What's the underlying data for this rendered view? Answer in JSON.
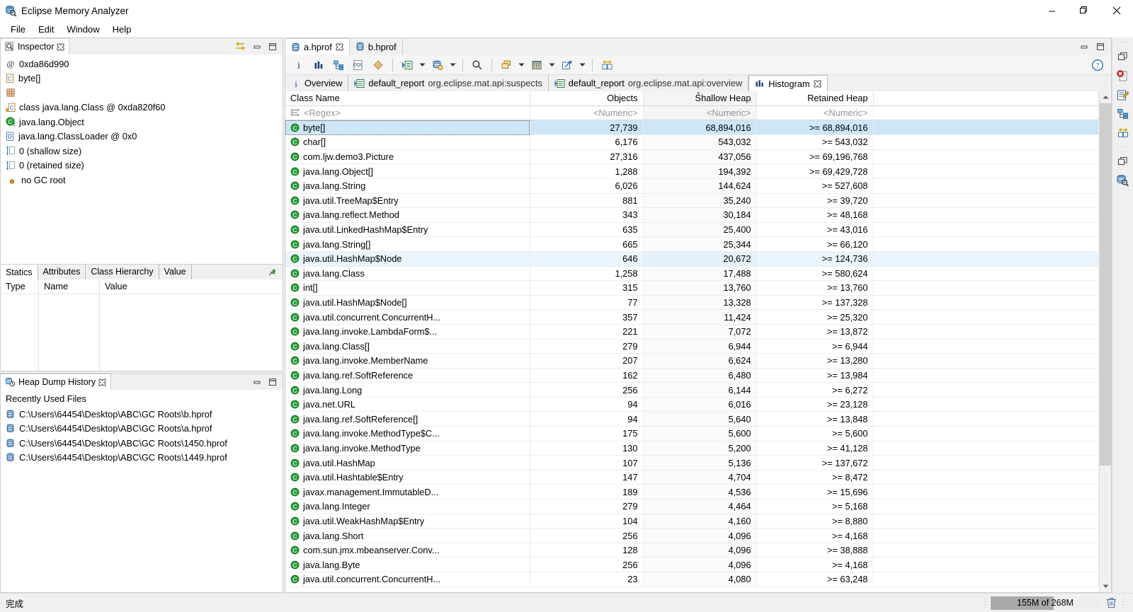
{
  "window": {
    "title": "Eclipse Memory Analyzer",
    "app_icon": "heap-dump-icon",
    "controls": {
      "minimize": "—",
      "maximize": "❐",
      "close": "✕"
    }
  },
  "menubar": {
    "items": [
      "File",
      "Edit",
      "Window",
      "Help"
    ]
  },
  "inspector": {
    "tab_label": "Inspector",
    "tab_icon": "inspector-icon",
    "tools": [
      "link-with-selection-icon",
      "minimize-view-icon",
      "maximize-view-icon"
    ],
    "lines": [
      {
        "icon": "at-address-icon",
        "text": "0xda86d990"
      },
      {
        "icon": "class-object-icon",
        "text": "byte[]"
      },
      {
        "icon": "array-grid-icon",
        "text": ""
      },
      {
        "icon": "class-ref-icon",
        "text": "class java.lang.Class @ 0xda820f60"
      },
      {
        "icon": "superclass-icon",
        "text": "java.lang.Object"
      },
      {
        "icon": "classloader-icon",
        "text": "java.lang.ClassLoader @ 0x0"
      },
      {
        "icon": "shallow-size-icon",
        "text": "0 (shallow size)"
      },
      {
        "icon": "retained-size-icon",
        "text": "0 (retained size)"
      },
      {
        "icon": "gc-root-icon",
        "text": "no GC root"
      }
    ],
    "tabs": [
      {
        "label": "Statics",
        "active": true
      },
      {
        "label": "Attributes",
        "active": false
      },
      {
        "label": "Class Hierarchy",
        "active": false
      },
      {
        "label": "Value",
        "active": false
      }
    ],
    "pin_icon": "pin-icon",
    "statics_columns": [
      "Type",
      "Name",
      "Value"
    ]
  },
  "heap_dump_history": {
    "tab_label": "Heap Dump History",
    "tab_icon": "heap-history-icon",
    "tools": [
      "minimize-view-icon",
      "maximize-view-icon"
    ],
    "section_title": "Recently Used Files",
    "files": [
      "C:\\Users\\64454\\Desktop\\ABC\\GC Roots\\b.hprof",
      "C:\\Users\\64454\\Desktop\\ABC\\GC Roots\\a.hprof",
      "C:\\Users\\64454\\Desktop\\ABC\\GC Roots\\1450.hprof",
      "C:\\Users\\64454\\Desktop\\ABC\\GC Roots\\1449.hprof"
    ]
  },
  "editor": {
    "tabs": [
      {
        "label": "a.hprof",
        "active": true,
        "closable": true
      },
      {
        "label": "b.hprof",
        "active": false,
        "closable": false
      }
    ],
    "tools": [
      "minimize-editor-icon",
      "maximize-editor-icon"
    ],
    "toolbar": [
      {
        "name": "overview-info-icon",
        "dropdown": false
      },
      {
        "name": "histogram-icon",
        "dropdown": false
      },
      {
        "name": "dominator-tree-icon",
        "dropdown": false
      },
      {
        "name": "oql-icon",
        "dropdown": false
      },
      {
        "name": "calculate-retained-icon",
        "dropdown": false
      },
      {
        "name": "run-report-icon",
        "dropdown": true
      },
      {
        "name": "query-browser-icon",
        "dropdown": true
      },
      {
        "name": "find-icon",
        "dropdown": false
      },
      {
        "name": "group-by-icon",
        "dropdown": true
      },
      {
        "name": "calculator-icon",
        "dropdown": true
      },
      {
        "name": "export-icon",
        "dropdown": true
      },
      {
        "name": "compare-icon",
        "dropdown": false
      }
    ],
    "help_icon": "help-icon",
    "result_tabs": [
      {
        "icon": "info-icon",
        "label": "Overview",
        "sublabel": "",
        "active": false
      },
      {
        "icon": "report-icon",
        "label": "default_report",
        "sublabel": "org.eclipse.mat.api:suspects",
        "active": false
      },
      {
        "icon": "report-icon",
        "label": "default_report",
        "sublabel": "org.eclipse.mat.api:overview",
        "active": false
      },
      {
        "icon": "histogram-icon",
        "label": "Histogram",
        "sublabel": "",
        "active": true,
        "closable": true
      }
    ]
  },
  "histogram": {
    "columns": [
      {
        "label": "Class Name",
        "align": "left",
        "sorted": false
      },
      {
        "label": "Objects",
        "align": "right",
        "sorted": false
      },
      {
        "label": "Shallow Heap",
        "align": "right",
        "sorted": true
      },
      {
        "label": "Retained Heap",
        "align": "right",
        "sorted": false
      }
    ],
    "filter_row": {
      "icon": "regex-filter-icon",
      "class_name": "<Regex>",
      "objects": "<Numeric>",
      "shallow": "<Numeric>",
      "retained": "<Numeric>"
    },
    "row_icon": "java-class-icon",
    "rows": [
      {
        "class_name": "byte[]",
        "objects": "27,739",
        "shallow": "68,894,016",
        "retained": ">= 68,894,016",
        "state": "selected"
      },
      {
        "class_name": "char[]",
        "objects": "6,176",
        "shallow": "543,032",
        "retained": ">= 543,032",
        "state": ""
      },
      {
        "class_name": "com.ljw.demo3.Picture",
        "objects": "27,316",
        "shallow": "437,056",
        "retained": ">= 69,196,768",
        "state": ""
      },
      {
        "class_name": "java.lang.Object[]",
        "objects": "1,288",
        "shallow": "194,392",
        "retained": ">= 69,429,728",
        "state": ""
      },
      {
        "class_name": "java.lang.String",
        "objects": "6,026",
        "shallow": "144,624",
        "retained": ">= 527,608",
        "state": ""
      },
      {
        "class_name": "java.util.TreeMap$Entry",
        "objects": "881",
        "shallow": "35,240",
        "retained": ">= 39,720",
        "state": ""
      },
      {
        "class_name": "java.lang.reflect.Method",
        "objects": "343",
        "shallow": "30,184",
        "retained": ">= 48,168",
        "state": ""
      },
      {
        "class_name": "java.util.LinkedHashMap$Entry",
        "objects": "635",
        "shallow": "25,400",
        "retained": ">= 43,016",
        "state": ""
      },
      {
        "class_name": "java.lang.String[]",
        "objects": "665",
        "shallow": "25,344",
        "retained": ">= 66,120",
        "state": ""
      },
      {
        "class_name": "java.util.HashMap$Node",
        "objects": "646",
        "shallow": "20,672",
        "retained": ">= 124,736",
        "state": "hl"
      },
      {
        "class_name": "java.lang.Class",
        "objects": "1,258",
        "shallow": "17,488",
        "retained": ">= 580,624",
        "state": ""
      },
      {
        "class_name": "int[]",
        "objects": "315",
        "shallow": "13,760",
        "retained": ">= 13,760",
        "state": ""
      },
      {
        "class_name": "java.util.HashMap$Node[]",
        "objects": "77",
        "shallow": "13,328",
        "retained": ">= 137,328",
        "state": ""
      },
      {
        "class_name": "java.util.concurrent.ConcurrentH...",
        "objects": "357",
        "shallow": "11,424",
        "retained": ">= 25,320",
        "state": ""
      },
      {
        "class_name": "java.lang.invoke.LambdaForm$...",
        "objects": "221",
        "shallow": "7,072",
        "retained": ">= 13,872",
        "state": ""
      },
      {
        "class_name": "java.lang.Class[]",
        "objects": "279",
        "shallow": "6,944",
        "retained": ">= 6,944",
        "state": ""
      },
      {
        "class_name": "java.lang.invoke.MemberName",
        "objects": "207",
        "shallow": "6,624",
        "retained": ">= 13,280",
        "state": ""
      },
      {
        "class_name": "java.lang.ref.SoftReference",
        "objects": "162",
        "shallow": "6,480",
        "retained": ">= 13,984",
        "state": ""
      },
      {
        "class_name": "java.lang.Long",
        "objects": "256",
        "shallow": "6,144",
        "retained": ">= 6,272",
        "state": ""
      },
      {
        "class_name": "java.net.URL",
        "objects": "94",
        "shallow": "6,016",
        "retained": ">= 23,128",
        "state": ""
      },
      {
        "class_name": "java.lang.ref.SoftReference[]",
        "objects": "94",
        "shallow": "5,640",
        "retained": ">= 13,848",
        "state": ""
      },
      {
        "class_name": "java.lang.invoke.MethodType$C...",
        "objects": "175",
        "shallow": "5,600",
        "retained": ">= 5,600",
        "state": ""
      },
      {
        "class_name": "java.lang.invoke.MethodType",
        "objects": "130",
        "shallow": "5,200",
        "retained": ">= 41,128",
        "state": ""
      },
      {
        "class_name": "java.util.HashMap",
        "objects": "107",
        "shallow": "5,136",
        "retained": ">= 137,672",
        "state": ""
      },
      {
        "class_name": "java.util.Hashtable$Entry",
        "objects": "147",
        "shallow": "4,704",
        "retained": ">= 8,472",
        "state": ""
      },
      {
        "class_name": "javax.management.ImmutableD...",
        "objects": "189",
        "shallow": "4,536",
        "retained": ">= 15,696",
        "state": ""
      },
      {
        "class_name": "java.lang.Integer",
        "objects": "279",
        "shallow": "4,464",
        "retained": ">= 5,168",
        "state": ""
      },
      {
        "class_name": "java.util.WeakHashMap$Entry",
        "objects": "104",
        "shallow": "4,160",
        "retained": ">= 8,880",
        "state": ""
      },
      {
        "class_name": "java.lang.Short",
        "objects": "256",
        "shallow": "4,096",
        "retained": ">= 4,168",
        "state": ""
      },
      {
        "class_name": "com.sun.jmx.mbeanserver.Conv...",
        "objects": "128",
        "shallow": "4,096",
        "retained": ">= 38,888",
        "state": ""
      },
      {
        "class_name": "java.lang.Byte",
        "objects": "256",
        "shallow": "4,096",
        "retained": ">= 4,168",
        "state": ""
      },
      {
        "class_name": "java.util.concurrent.ConcurrentH...",
        "objects": "23",
        "shallow": "4,080",
        "retained": ">= 63,248",
        "state": ""
      }
    ]
  },
  "fastview": {
    "icons": [
      "restore-perspective-icon",
      "error-log-icon",
      "notes-editor-icon",
      "dominator-tree-view-icon",
      "compare-basket-icon",
      "restore-view-icon",
      "inspector-view-icon"
    ]
  },
  "statusbar": {
    "message": "完成",
    "heap": {
      "used_label": "155M of 268M",
      "percent": 58
    },
    "trash_icon": "trash-icon"
  }
}
